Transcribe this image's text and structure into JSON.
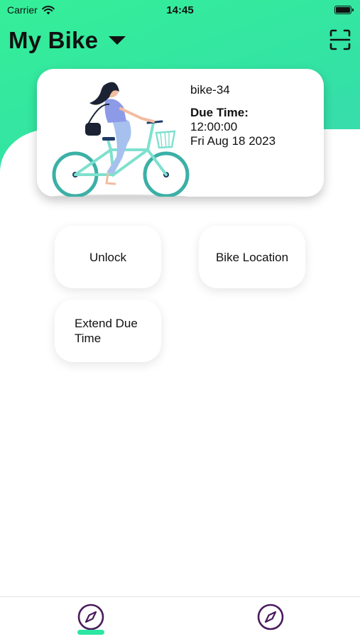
{
  "status_bar": {
    "carrier": "Carrier",
    "time": "14:45"
  },
  "header": {
    "title": "My Bike"
  },
  "bike_card": {
    "bike_id": "bike-34",
    "due_label": "Due Time:",
    "due_time": "12:00:00",
    "due_date": "Fri Aug 18 2023"
  },
  "actions": {
    "unlock": "Unlock",
    "bike_location": "Bike Location",
    "extend_due_time": "Extend Due Time"
  },
  "tabs": [
    {
      "icon": "compass-icon",
      "active": true
    },
    {
      "icon": "compass-icon",
      "active": false
    }
  ],
  "colors": {
    "accent": "#35ef98",
    "tab_icon": "#4a1a5c",
    "tab_indicator": "#2de6a3"
  }
}
